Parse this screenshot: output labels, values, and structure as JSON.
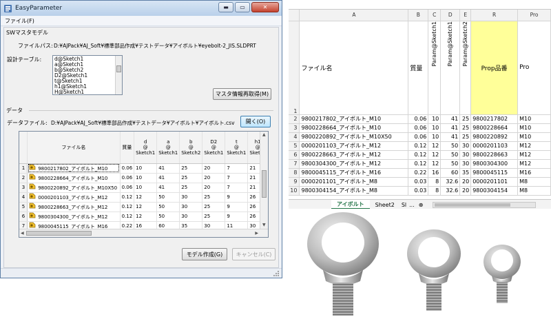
{
  "window": {
    "title": "EasyParameter",
    "menu_file": "ファイル(F)",
    "buttons": {
      "minimize": "▬",
      "maximize": "▭",
      "close": "✕"
    }
  },
  "sw_model": {
    "group_label": "SWマスタモデル",
    "file_path_label": "ファイルパス:",
    "file_path": "D:¥AJPack¥AJ_Soft¥標準部品作成¥テストデータ¥アイボルト¥eyebolt-2_JIS.SLDPRT",
    "design_table_label": "設計テーブル:",
    "design_table_items": [
      "d@Sketch1",
      "a@Sketch1",
      "b@Sketch2",
      "D2@Sketch1",
      "t@Sketch1",
      "h1@Sketch1",
      "H@Sketch1"
    ],
    "reload_button": "マスタ情報再取得(M)"
  },
  "data_section": {
    "group_label": "データ",
    "data_file_label": "データファイル:",
    "data_file_path": "D:¥AJPack¥AJ_Soft¥標準部品作成¥テストデータ¥アイボルト¥アイボルト.csv",
    "open_button": "開く(O)",
    "grid": {
      "headers": [
        "ファイル名",
        "質量",
        "d\n@\nSketch1",
        "a\n@\nSketch1",
        "b\n@\nSketch2",
        "D2\n@\nSketch1",
        "t\n@\nSketch1",
        "h1\n@\nSketch"
      ],
      "rows": [
        [
          "1",
          "9800217802_アイボルト_M10",
          "0.06",
          "10",
          "41",
          "25",
          "20",
          "7",
          "21"
        ],
        [
          "2",
          "9800228664_アイボルト_M10",
          "0.06",
          "10",
          "41",
          "25",
          "20",
          "7",
          "21"
        ],
        [
          "3",
          "9800220892_アイボルト_M10X50",
          "0.06",
          "10",
          "41",
          "25",
          "20",
          "7",
          "21"
        ],
        [
          "4",
          "0000201103_アイボルト_M12",
          "0.12",
          "12",
          "50",
          "30",
          "25",
          "9",
          "26"
        ],
        [
          "5",
          "9800228663_アイボルト_M12",
          "0.12",
          "12",
          "50",
          "30",
          "25",
          "9",
          "26"
        ],
        [
          "6",
          "9800304300_アイボルト_M12",
          "0.12",
          "12",
          "50",
          "30",
          "25",
          "9",
          "26"
        ],
        [
          "7",
          "9800045115_アイボルト_M16",
          "0.22",
          "16",
          "60",
          "35",
          "30",
          "11",
          "30"
        ]
      ]
    }
  },
  "actions": {
    "create_button": "モデル作成(G)",
    "cancel_button": "キャンセル(C)"
  },
  "spreadsheet": {
    "columns": [
      "A",
      "B",
      "C",
      "D",
      "E",
      "R",
      "Pro"
    ],
    "header_row": {
      "row_num": "1",
      "file_name": "ファイル名",
      "mass": "質量",
      "c": "Param@Sketch1",
      "d": "Param@Sketch1",
      "e": "Param@Sketch2",
      "r": "Prop品番",
      "last": "Pro"
    },
    "rows": [
      [
        "2",
        "9800217802_アイボルト_M10",
        "0.06",
        "10",
        "41",
        "25",
        "9800217802",
        "M10"
      ],
      [
        "3",
        "9800228664_アイボルト_M10",
        "0.06",
        "10",
        "41",
        "25",
        "9800228664",
        "M10"
      ],
      [
        "4",
        "9800220892_アイボルト_M10X50",
        "0.06",
        "10",
        "41",
        "25",
        "9800220892",
        "M10"
      ],
      [
        "5",
        "0000201103_アイボルト_M12",
        "0.12",
        "12",
        "50",
        "30",
        "0000201103",
        "M12"
      ],
      [
        "6",
        "9800228663_アイボルト_M12",
        "0.12",
        "12",
        "50",
        "30",
        "9800228663",
        "M12"
      ],
      [
        "7",
        "9800304300_アイボルト_M12",
        "0.12",
        "12",
        "50",
        "30",
        "9800304300",
        "M12"
      ],
      [
        "8",
        "9800045115_アイボルト_M16",
        "0.22",
        "16",
        "60",
        "35",
        "9800045115",
        "M16"
      ],
      [
        "9",
        "0000201101_アイボルト_M8",
        "0.03",
        "8",
        "32.6",
        "20",
        "0000201101",
        "M8"
      ],
      [
        "10",
        "9800304154_アイボルト_M8",
        "0.03",
        "8",
        "32.6",
        "20",
        "9800304154",
        "M8"
      ]
    ],
    "tabs": [
      "アイボルト",
      "Sheet2",
      "Sl",
      "..."
    ],
    "add_sheet": "⊕"
  },
  "colors": {
    "highlight_column": "#ffff99",
    "excel_green": "#217346",
    "titlebar": "#c5d9ef"
  }
}
